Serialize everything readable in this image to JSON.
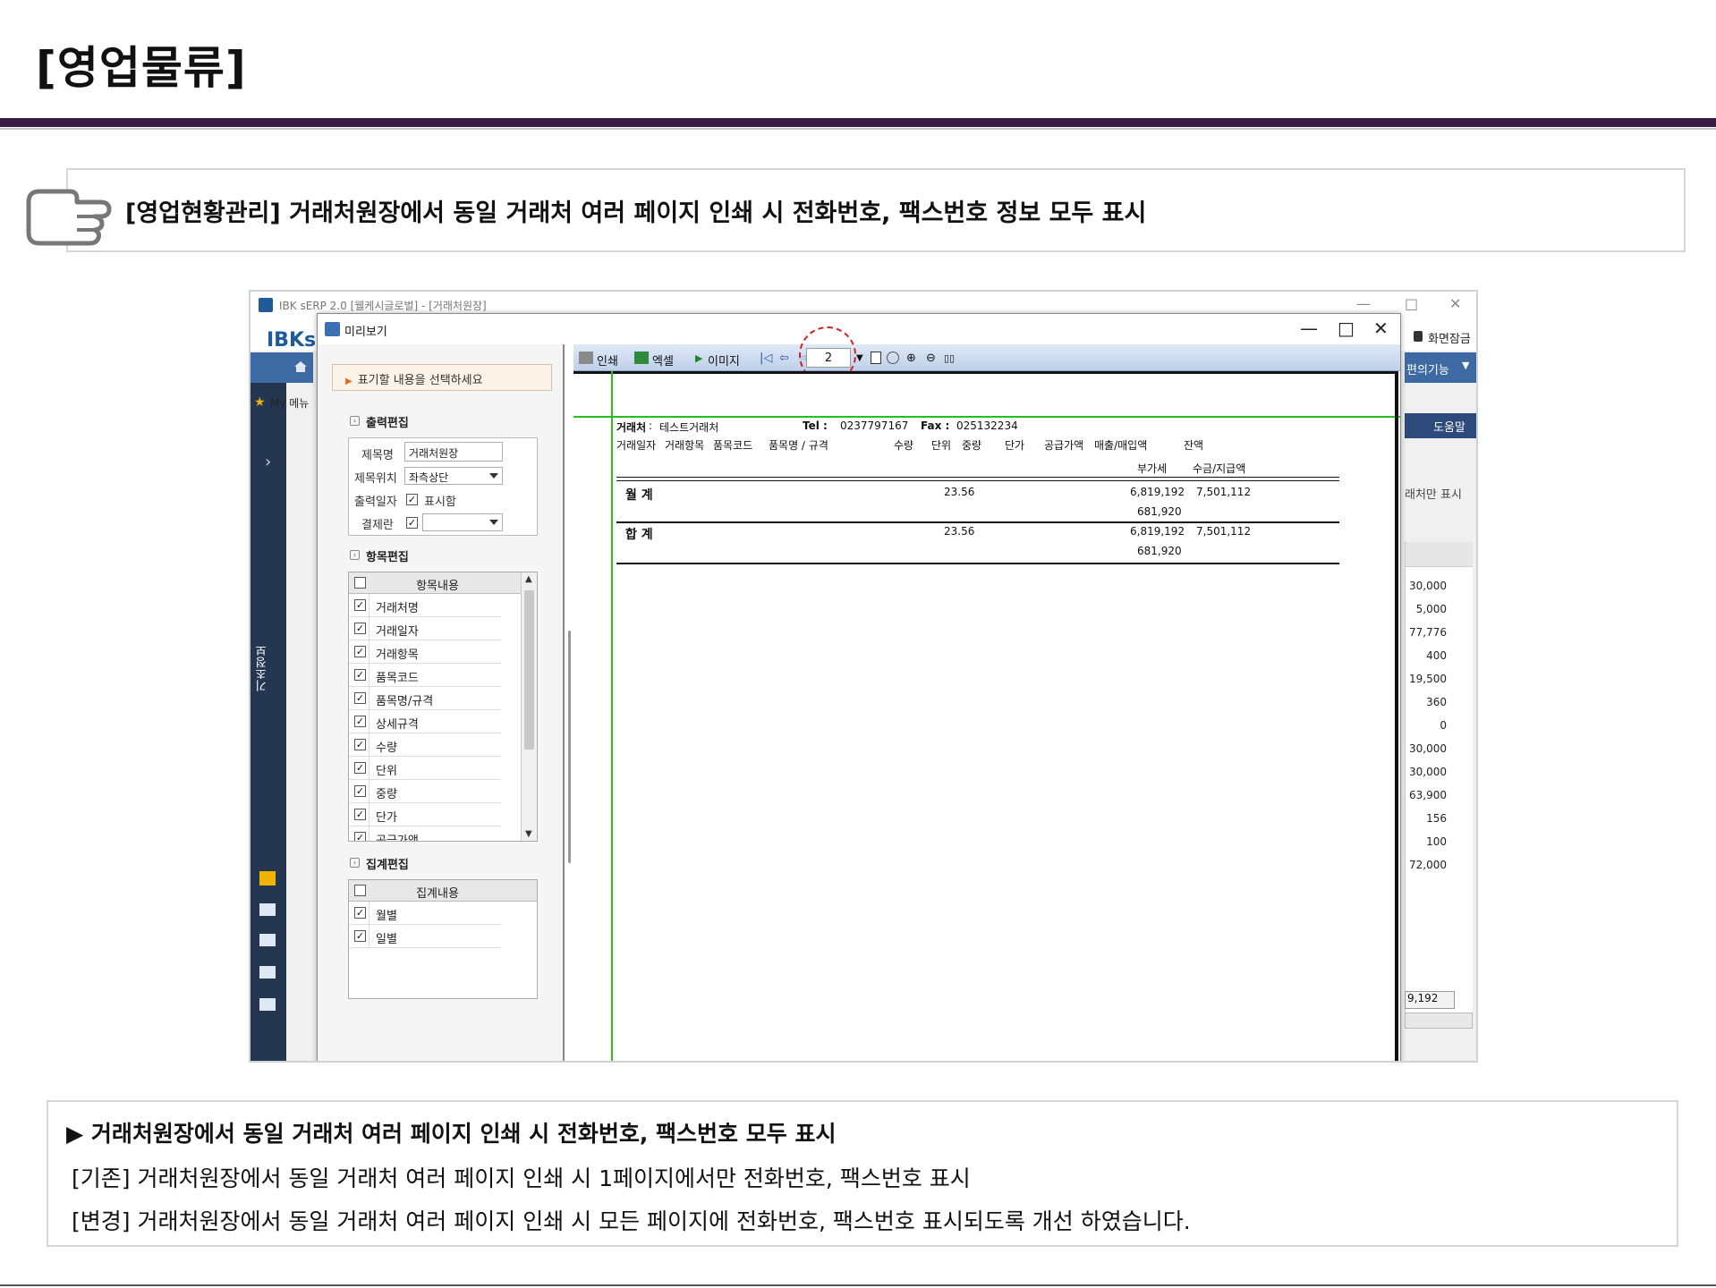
{
  "slide": {
    "title": "[영업물류]",
    "headline": "[영업현황관리] 거래처원장에서 동일 거래처 여러 페이지 인쇄 시 전화번호, 팩스번호 정보 모두 표시"
  },
  "erp": {
    "window_title": "IBK sERP 2.0 [웰케시글로벌] - [거래처원장]",
    "logo": "IBKs",
    "screen_lock": "화면잠금",
    "convenience": "편의기능",
    "help": "도움말",
    "my_menu": "My 메뉴",
    "main_tab": "메인",
    "side_vertical_label": "기초정보",
    "only_label": "래처만 표시",
    "right_values": [
      "30,000",
      "5,000",
      "77,776",
      "400",
      "19,500",
      "360",
      "0",
      "30,000",
      "30,000",
      "63,900",
      "156",
      "100",
      "72,000"
    ],
    "right_sum": "9,192"
  },
  "preview": {
    "title": "미리보기",
    "hint": "표기할 내용을 선택하세요",
    "output_section": "출력편집",
    "form": {
      "title_label": "제목명",
      "title_value": "거래처원장",
      "position_label": "제목위치",
      "position_value": "좌측상단",
      "date_label": "출력일자",
      "date_check_label": "표시함",
      "approval_label": "결제란",
      "approval_value": ""
    },
    "item_section": "항목편집",
    "item_header": "항목내용",
    "items": [
      "거래처명",
      "거래일자",
      "거래항목",
      "품목코드",
      "품목명/규격",
      "상세규격",
      "수량",
      "단위",
      "중량",
      "단가",
      "공급가액"
    ],
    "summary_section": "집계편집",
    "summary_header": "집계내용",
    "summary_items": [
      "월별",
      "일별"
    ],
    "toolbar": {
      "print": "인쇄",
      "excel": "엑셀",
      "image": "이미지",
      "page": "2"
    }
  },
  "report": {
    "client_label": "거래처",
    "client_value": "테스트거래처",
    "tel_label": "Tel :",
    "tel_value": "0237797167",
    "fax_label": "Fax :",
    "fax_value": "025132234",
    "headers": [
      "거래일자",
      "거래항목",
      "품목코드",
      "품목명 / 규격",
      "수량",
      "단위",
      "중량",
      "단가",
      "공급가액",
      "매출/매입액",
      "잔액"
    ],
    "headers2": [
      "부가세",
      "수금/지급액"
    ],
    "month_label": "월 계",
    "total_label": "합 계",
    "qty": "23.56",
    "supply": "6,819,192",
    "sales": "7,501,112",
    "vat": "681,920"
  },
  "summary": {
    "title": "▶ 거래처원장에서 동일 거래처 여러 페이지 인쇄 시 전화번호, 팩스번호 모두 표시",
    "before": "[기존] 거래처원장에서 동일 거래처 여러 페이지 인쇄 시 1페이지에서만 전화번호, 팩스번호 표시",
    "after": "[변경] 거래처원장에서 동일 거래처 여러 페이지 인쇄 시 모든 페이지에 전화번호, 팩스번호 표시되도록 개선 하였습니다."
  },
  "colors": {
    "rule": "#3a1d46",
    "erp_nav": "#253650",
    "erp_accent": "#3e6aa3",
    "guide_line": "#22c022",
    "highlight": "#d02020"
  }
}
